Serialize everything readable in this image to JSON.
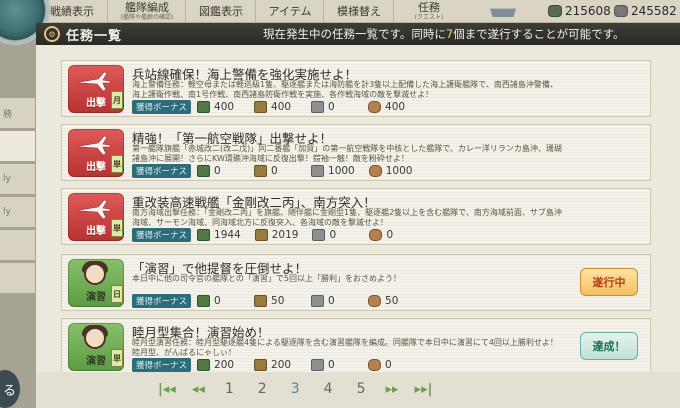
{
  "nav": {
    "items": [
      {
        "label": "戦績表示"
      },
      {
        "label": "艦隊編成",
        "sub": "(艦隊や艦娘の確認)"
      },
      {
        "label": "図鑑表示"
      },
      {
        "label": "アイテム"
      },
      {
        "label": "模様替え"
      },
      {
        "label": "任務",
        "sub": "(クエスト)"
      }
    ],
    "resources": [
      {
        "name": "fuel-amount",
        "value": "215608"
      },
      {
        "name": "steel-amount",
        "value": "245582"
      }
    ]
  },
  "sidetabs": [
    "務",
    "",
    "ly",
    "ly",
    "",
    ""
  ],
  "header": {
    "title": "任務一覧",
    "desc_prefix": "現在発生中の任務一覧です。同時に",
    "desc_num": "7",
    "desc_suffix": "個まで遂行することが可能です。"
  },
  "quests": [
    {
      "category": "出撃",
      "category_type": "sortie",
      "frequency": "月",
      "title": "兵站線確保！海上警備を強化実施せよ！",
      "desc": "海上警備任務：軽空母または軽巡級1隻、駆逐艦または海防艦を計3隻以上配備した海上護衛艦隊で、南西諸島沖警備、海上護衛作戦、南1号作戦、南西諸島防衛作戦を実施、各作戦海域の敵を撃滅せよ！",
      "bonus": "獲得ボーナス",
      "rewards": [
        "400",
        "400",
        "0",
        "400"
      ],
      "status": ""
    },
    {
      "category": "出撃",
      "category_type": "sortie",
      "frequency": "単",
      "title": "精強！「第一航空戦隊」出撃せよ！",
      "desc": "第一艦隊旗艦「赤城改二(改二戊)」同二番艦「加賀」の第一航空戦隊を中核とした艦隊で、カレー洋リランカ島沖、珊瑚諸島沖に展開！さらにKW環礁沖海域に反復出撃！鎧袖一触！敵を粉砕せよ！",
      "bonus": "獲得ボーナス",
      "rewards": [
        "0",
        "0",
        "1000",
        "1000"
      ],
      "status": ""
    },
    {
      "category": "出撃",
      "category_type": "sortie",
      "frequency": "単",
      "title": "重改装高速戦艦「金剛改二丙」、南方突入！",
      "desc": "南方海域出撃任務：「金剛改二丙」を旗艦、随伴艦に金剛型1隻、駆逐艦2隻以上を含む艦隊で、南方海域前面、サブ島沖海域、サーモン海域、同海域北方に反復突入、各海域の敵を撃滅せよ！",
      "bonus": "獲得ボーナス",
      "rewards": [
        "1944",
        "2019",
        "0",
        "0"
      ],
      "status": ""
    },
    {
      "category": "演習",
      "category_type": "exercise",
      "frequency": "日",
      "title": "「演習」で他提督を圧倒せよ！",
      "desc": "本日中に他の司令官の艦隊との「演習」で5回以上「勝利」をおさめよう！",
      "bonus": "獲得ボーナス",
      "rewards": [
        "0",
        "50",
        "0",
        "50"
      ],
      "status": "遂行中"
    },
    {
      "category": "演習",
      "category_type": "exercise",
      "frequency": "単",
      "title": "睦月型集合！演習始め！",
      "desc": "睦月型演習任務：睦月型駆逐艦4隻による駆逐隊を含む演習艦隊を編成。同艦隊で本日中に演習にて4回以上勝利せよ！睦月型、がんばるにゃしぃ！",
      "bonus": "獲得ボーナス",
      "rewards": [
        "200",
        "200",
        "0",
        "0"
      ],
      "status": "達成！"
    }
  ],
  "pager": {
    "pages": [
      "1",
      "2",
      "3",
      "4",
      "5"
    ],
    "current": "3"
  },
  "back_label": "る"
}
